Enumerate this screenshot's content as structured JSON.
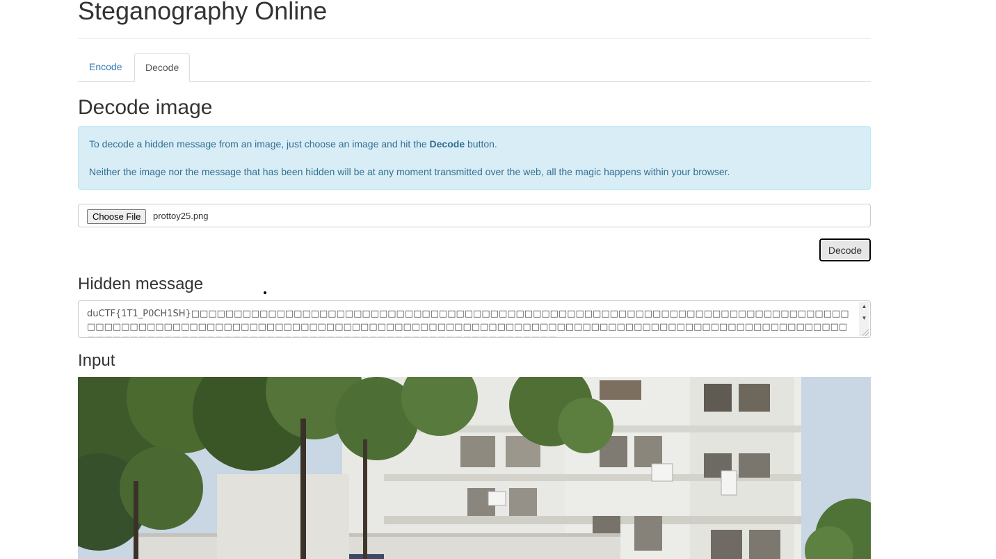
{
  "header": {
    "title": "Steganography Online"
  },
  "tabs": [
    {
      "label": "Encode",
      "active": false
    },
    {
      "label": "Decode",
      "active": true
    }
  ],
  "decode_section": {
    "title": "Decode image",
    "info": {
      "line1_prefix": "To decode a hidden message from an image, just choose an image and hit the ",
      "line1_bold": "Decode",
      "line1_suffix": " button.",
      "line2": "Neither the image nor the message that has been hidden will be at any moment transmitted over the web, all the magic happens within your browser."
    },
    "file_input": {
      "button_label": "Choose File",
      "file_name": "prottoy25.png"
    },
    "decode_button_label": "Decode"
  },
  "hidden_message": {
    "title": "Hidden message",
    "value": "duCTF{1T1_P0CH1SH}□□□□□□□□□□□□□□□□□□□□□□□□□□□□□□□□□□□□□□□□□□□□□□□□□□□□□□□□□□□□□□□□□□□□□□□□□□□□□□□□□□□□□□□□□□□□□□□□□□□□□□□□□□□□□□□□□□□□□□□□□□□□□□□□□□□□□□□□□□□□□□□□□□□□□□□□□□□□□□□□□□□□□□□□□□□□□□□□□□□□□□□□□□□□□□□□□□□□□□□□□□□□□□□□□□□□□□□□□□□□□"
  },
  "input_section": {
    "title": "Input"
  },
  "colors": {
    "link": "#337ab7",
    "alert_bg": "#d9edf7",
    "alert_text": "#31708f"
  }
}
